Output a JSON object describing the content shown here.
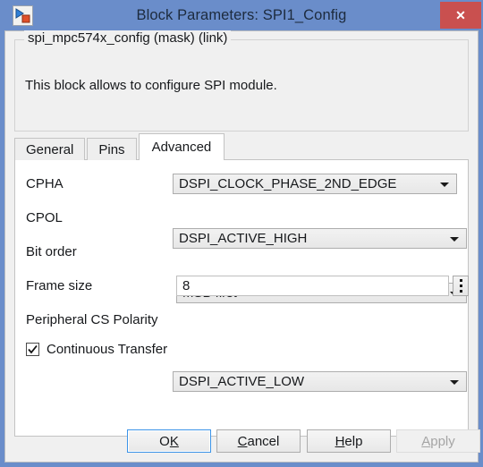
{
  "window": {
    "title": "Block Parameters: SPI1_Config",
    "icon": "simulink-block-icon",
    "close_label": "✕",
    "accent_color": "#6a8dca",
    "close_color": "#c9504f"
  },
  "group": {
    "legend": "spi_mpc574x_config (mask) (link)",
    "description": "This block allows to configure SPI module."
  },
  "tabs": [
    {
      "label": "General",
      "active": false
    },
    {
      "label": "Pins",
      "active": false
    },
    {
      "label": "Advanced",
      "active": true
    }
  ],
  "fields": [
    {
      "label": "CPHA",
      "type": "combobox",
      "value": "DSPI_CLOCK_PHASE_2ND_EDGE",
      "name": "cpha"
    },
    {
      "label": "CPOL",
      "type": "combobox",
      "value": "DSPI_ACTIVE_HIGH",
      "name": "cpol"
    },
    {
      "label": "Bit order",
      "type": "combobox",
      "value": "MSB first",
      "name": "bit-order"
    },
    {
      "label": "Frame size",
      "type": "textfield",
      "value": "8",
      "name": "frame-size"
    },
    {
      "label": "Peripheral CS Polarity",
      "type": "combobox",
      "value": "DSPI_ACTIVE_LOW",
      "name": "peripheral-cs-polarity"
    }
  ],
  "checkbox": {
    "label": "Continuous Transfer",
    "checked": true
  },
  "buttons": {
    "ok": {
      "pre": "O",
      "mnemonic": "K",
      "post": "",
      "state": "default"
    },
    "cancel": {
      "pre": "",
      "mnemonic": "C",
      "post": "ancel",
      "state": "normal"
    },
    "help": {
      "pre": "",
      "mnemonic": "H",
      "post": "elp",
      "state": "normal"
    },
    "apply": {
      "pre": "",
      "mnemonic": "A",
      "post": "pply",
      "state": "disabled"
    }
  }
}
